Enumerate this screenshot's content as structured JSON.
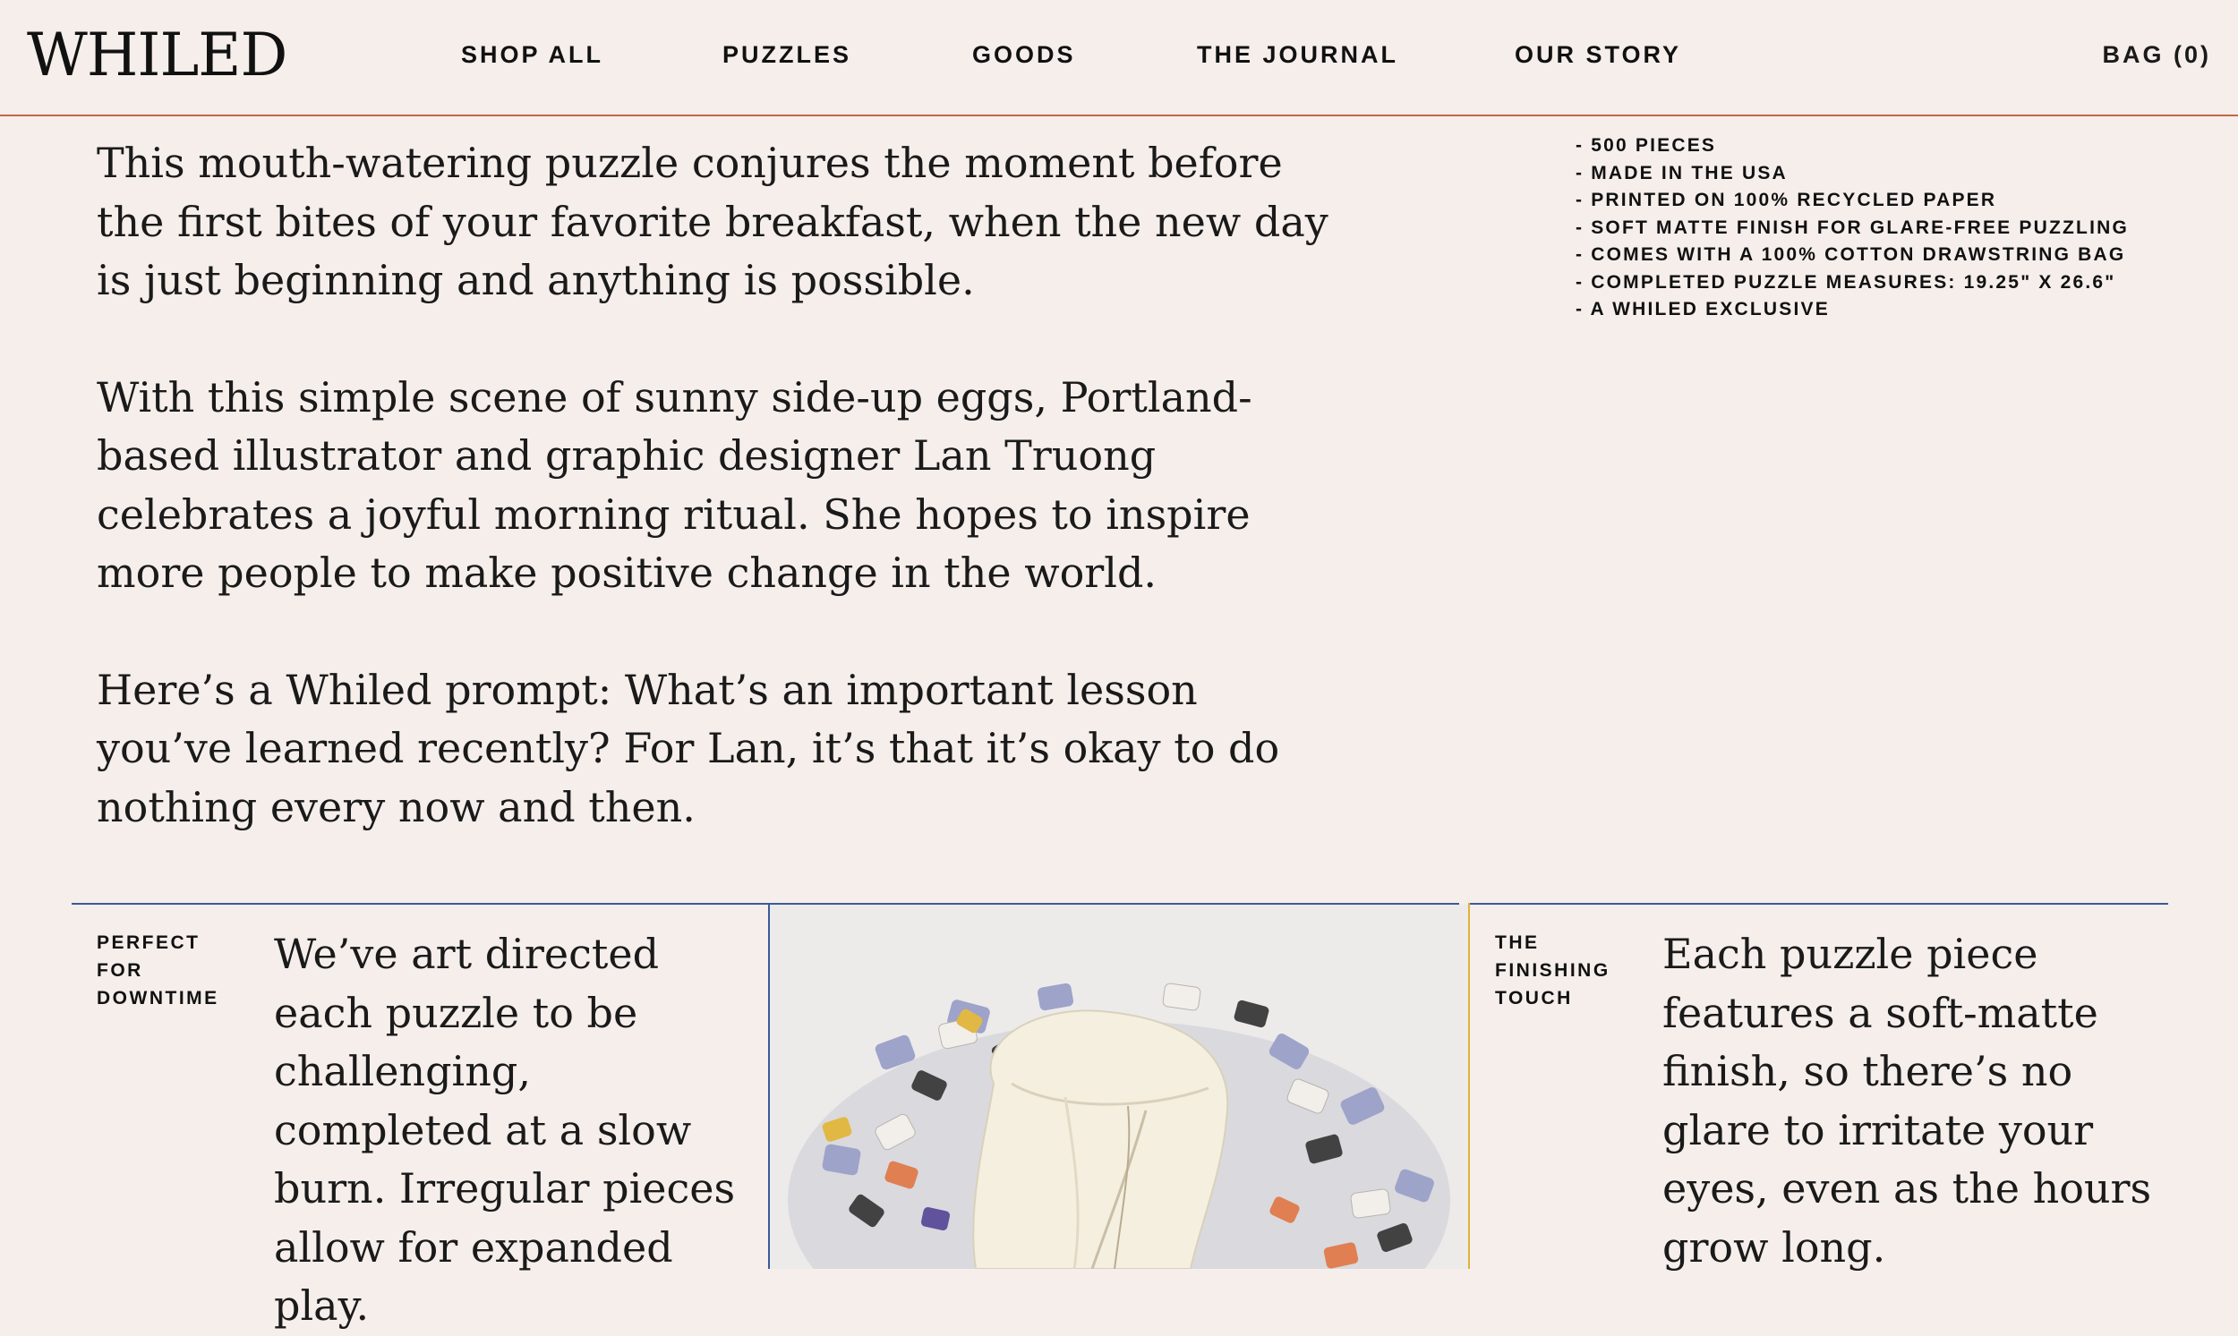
{
  "brand": {
    "logo": "WHILED"
  },
  "nav": {
    "items": [
      {
        "label": "SHOP ALL"
      },
      {
        "label": "PUZZLES"
      },
      {
        "label": "GOODS"
      },
      {
        "label": "THE JOURNAL"
      },
      {
        "label": "OUR STORY"
      }
    ],
    "bag": "BAG (0)"
  },
  "description": {
    "paragraphs": [
      "This mouth-watering puzzle conjures the moment before the first bites of your favorite breakfast, when the new day is just beginning and anything is possible.",
      "With this simple scene of sunny side-up eggs, Portland-based illustrator and graphic designer Lan Truong celebrates a joyful morning ritual. She hopes to inspire more people to make positive change in the world.",
      "Here’s a Whiled prompt: What’s an important lesson you’ve learned recently? For Lan, it’s that it’s okay to do nothing every now and then."
    ]
  },
  "features": [
    "- 500 PIECES",
    "- MADE IN THE USA",
    "- PRINTED ON 100% RECYCLED PAPER",
    "- SOFT MATTE FINISH FOR GLARE-FREE PUZZLING",
    "- COMES WITH A 100% COTTON DRAWSTRING BAG",
    "- COMPLETED PUZZLE MEASURES: 19.25\" X 26.6\"",
    "- A WHILED EXCLUSIVE"
  ],
  "blocks": {
    "left": {
      "label_lines": [
        "PERFECT",
        "FOR",
        "DOWNTIME"
      ],
      "text": "We’ve art directed each puzzle to be challenging, completed at a slow burn. Irregular pieces allow for expanded play."
    },
    "right": {
      "label_lines": [
        "THE",
        "FINISHING",
        "TOUCH"
      ],
      "text": "Each puzzle piece features a soft-matte finish, so there’s no glare to irritate your eyes, even as the hours grow long."
    }
  },
  "colors": {
    "background": "#f5eeeb",
    "header_rule": "#c0674a",
    "divider_blue": "#3b5a9a",
    "divider_yellow": "#e0b33a"
  }
}
